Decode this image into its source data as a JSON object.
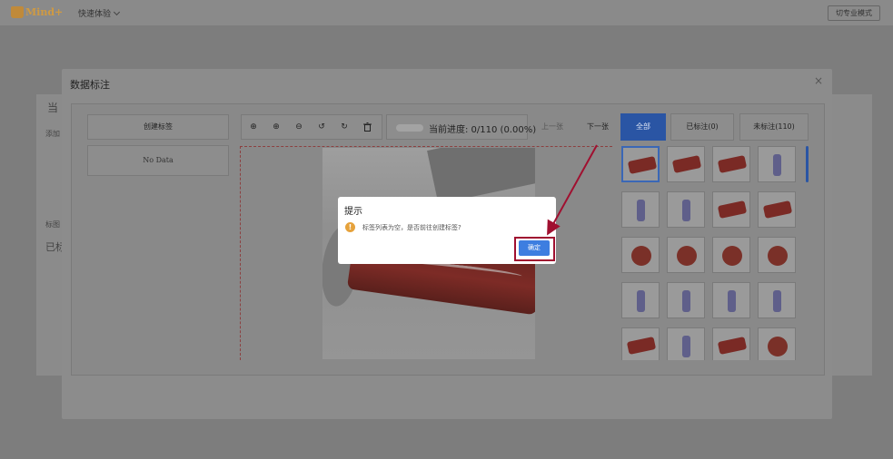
{
  "app": {
    "logo_text": "Mind+",
    "quick_experience": "快速体验",
    "pro_mode": "切专业模式"
  },
  "background": {
    "text1": "当",
    "text2": "添加",
    "text3": "标图",
    "text4": "已标"
  },
  "modal": {
    "title": "数据标注",
    "close_glyph": "×",
    "create_tag_label": "创建标签",
    "no_data": "No Data",
    "progress_text": "当前进度: 0/110 (0.00%)",
    "prev_label": "上一张",
    "next_label": "下一张",
    "filter_all": "全部",
    "filter_labeled": "已标注(0)",
    "filter_unlabeled": "未标注(110)"
  },
  "toolbar": {
    "tools": [
      {
        "name": "crosshair-icon",
        "glyph": "⊕"
      },
      {
        "name": "zoom-in-icon",
        "glyph": "⊕"
      },
      {
        "name": "zoom-out-icon",
        "glyph": "⊖"
      },
      {
        "name": "rotate-left-icon",
        "glyph": "↺"
      },
      {
        "name": "rotate-right-icon",
        "glyph": "↻"
      },
      {
        "name": "delete-icon",
        "glyph": "🗑"
      }
    ]
  },
  "dialog": {
    "title": "提示",
    "icon_glyph": "!",
    "message": "标签列表为空，是否前往创建标签?",
    "ok_label": "确定"
  },
  "colors": {
    "accent": "#2a55a4",
    "ok_button": "#3d7ee0",
    "annotation": "#a01030",
    "warning": "#e6a23c"
  }
}
